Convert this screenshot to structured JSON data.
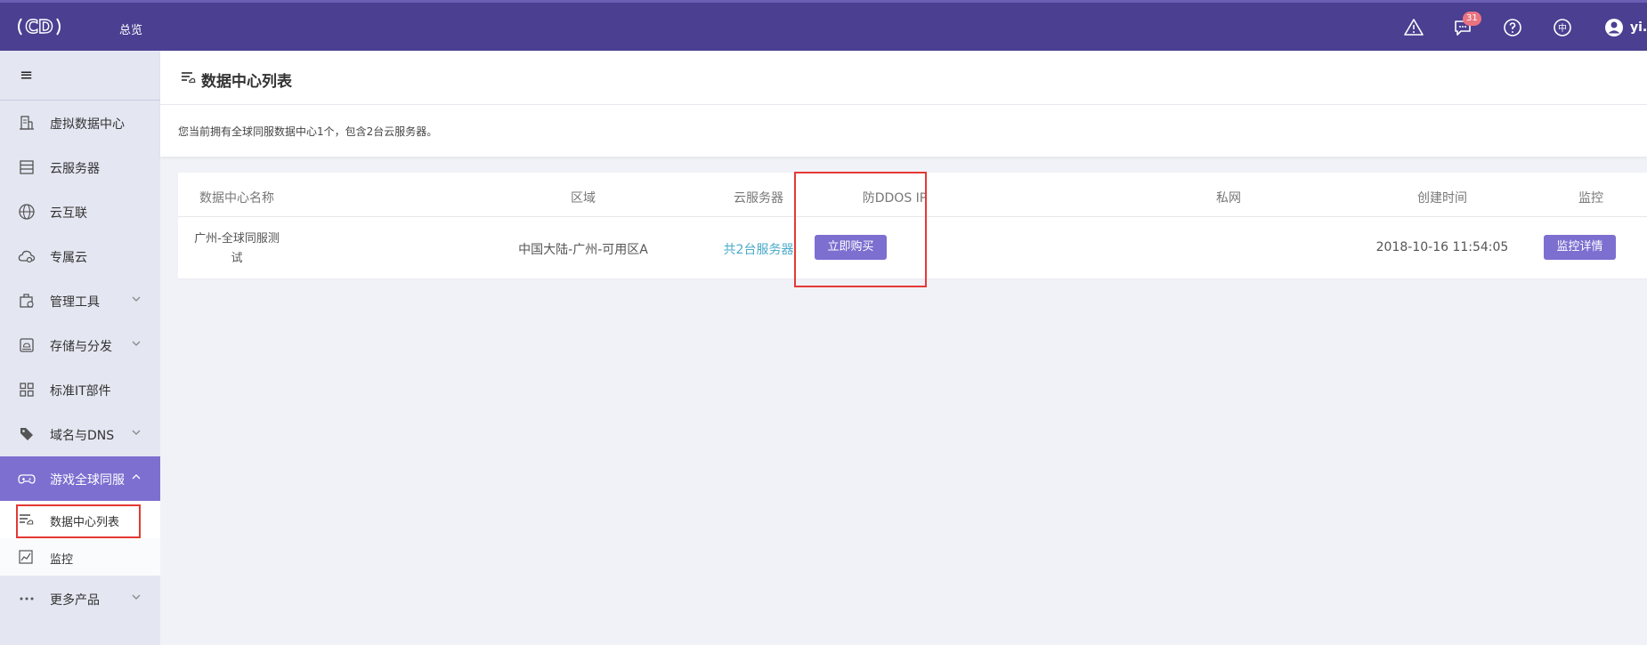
{
  "header": {
    "logo_text": "CD",
    "nav_overview": "总览",
    "messages_badge": "31",
    "lang_label": "中",
    "user_name": "yi.p"
  },
  "sidebar": {
    "toggle_label": "≡",
    "items": [
      {
        "label": "虚拟数据中心",
        "icon": "building-icon"
      },
      {
        "label": "云服务器",
        "icon": "server-icon"
      },
      {
        "label": "云互联",
        "icon": "globe-icon"
      },
      {
        "label": "专属云",
        "icon": "cloud-icon"
      },
      {
        "label": "管理工具",
        "icon": "tools-icon",
        "expandable": true
      },
      {
        "label": "存储与分发",
        "icon": "storage-icon",
        "expandable": true
      },
      {
        "label": "标准IT部件",
        "icon": "grid-icon"
      },
      {
        "label": "域名与DNS",
        "icon": "tag-icon",
        "expandable": true
      },
      {
        "label": "游戏全球同服",
        "icon": "gamepad-icon",
        "expandable": true,
        "active": true
      }
    ],
    "subitems": [
      {
        "label": "数据中心列表",
        "icon": "list-icon",
        "selected": true
      },
      {
        "label": "监控",
        "icon": "chart-icon"
      }
    ],
    "more": {
      "label": "更多产品",
      "icon": "more-icon"
    }
  },
  "page": {
    "title": "数据中心列表",
    "summary": "您当前拥有全球同服数据中心1个，包含2台云服务器。"
  },
  "table": {
    "columns": [
      "数据中心名称",
      "区域",
      "云服务器",
      "防DDOS IP",
      "私网",
      "创建时间",
      "监控"
    ],
    "rows": [
      {
        "name_line1": "广州-全球同服测",
        "name_line2": "试",
        "region": "中国大陆-广州-可用区A",
        "servers": "共2台服务器",
        "ddos_button": "立即购买",
        "private_network": "",
        "created": "2018-10-16 11:54:05",
        "monitor_button": "监控详情"
      }
    ]
  },
  "colors": {
    "topbar": "#4a3f91",
    "accent": "#7c6fd0",
    "link": "#4aa9c9",
    "highlight": "#e53935",
    "badge": "#e9737f"
  }
}
